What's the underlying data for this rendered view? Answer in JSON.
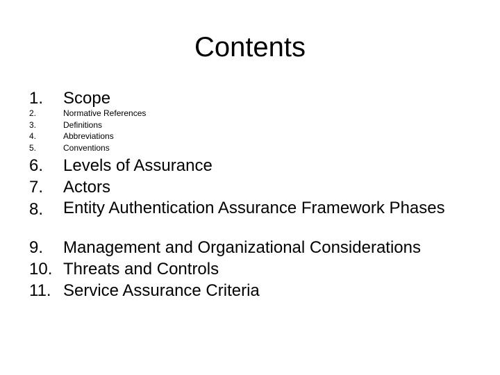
{
  "slide": {
    "title": "Contents",
    "items": [
      {
        "number": "1.",
        "label": "Scope",
        "level": "main"
      },
      {
        "number": "2.",
        "label": "Normative References",
        "level": "sub"
      },
      {
        "number": "3.",
        "label": "Definitions",
        "level": "sub"
      },
      {
        "number": "4.",
        "label": "Abbreviations",
        "level": "sub"
      },
      {
        "number": "5.",
        "label": "Conventions",
        "level": "sub"
      },
      {
        "number": "6.",
        "label": "Levels of Assurance",
        "level": "main"
      },
      {
        "number": "7.",
        "label": "Actors",
        "level": "main"
      },
      {
        "number": "8.",
        "label": "Entity Authentication Assurance Framework Phases",
        "level": "main"
      },
      {
        "number": "9.",
        "label": "Management and Organizational Considerations",
        "level": "main"
      },
      {
        "number": "10.",
        "label": "Threats and Controls",
        "level": "main"
      },
      {
        "number": "11.",
        "label": "Service Assurance Criteria",
        "level": "main"
      }
    ]
  }
}
